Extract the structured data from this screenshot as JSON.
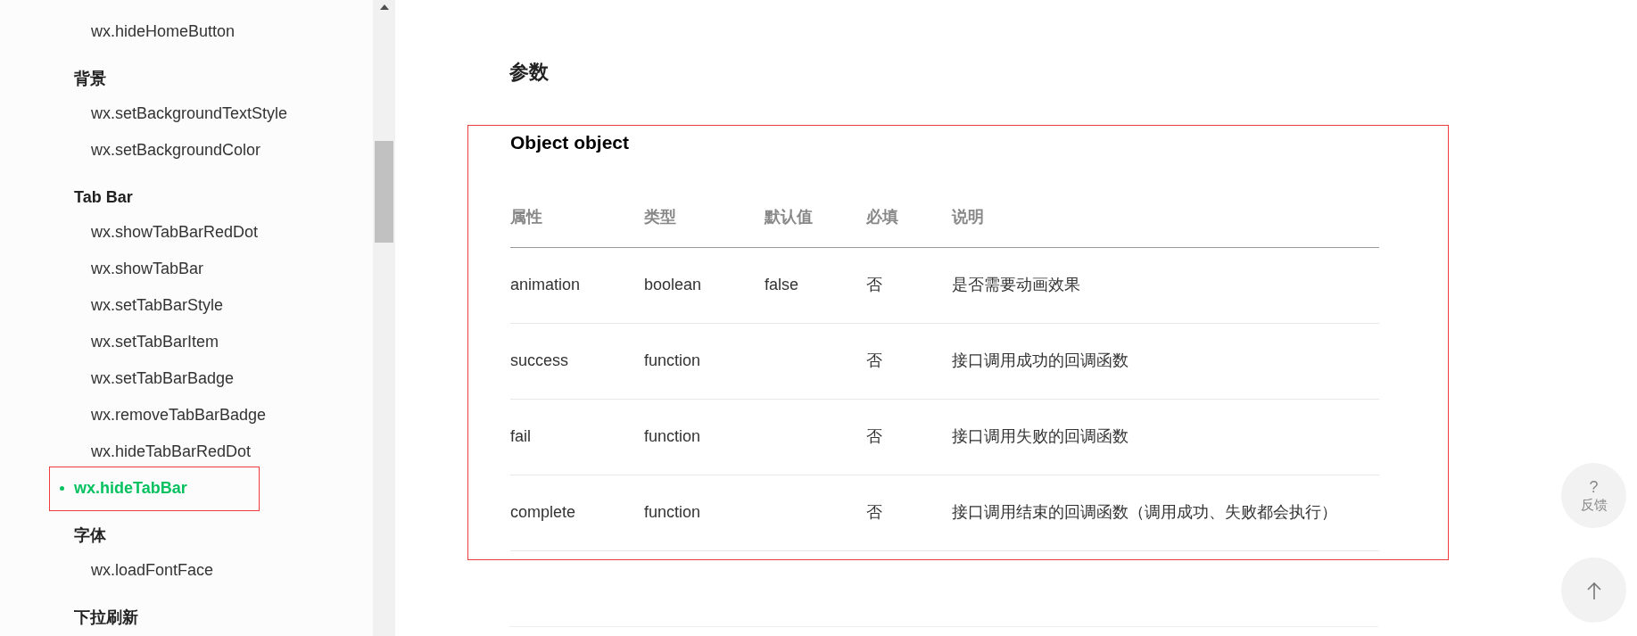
{
  "sidebar": {
    "groups": [
      {
        "items": [
          {
            "label": "wx.hideHomeButton",
            "selected": false
          }
        ]
      },
      {
        "title": "背景",
        "items": [
          {
            "label": "wx.setBackgroundTextStyle",
            "selected": false
          },
          {
            "label": "wx.setBackgroundColor",
            "selected": false
          }
        ]
      },
      {
        "title": "Tab Bar",
        "items": [
          {
            "label": "wx.showTabBarRedDot",
            "selected": false
          },
          {
            "label": "wx.showTabBar",
            "selected": false
          },
          {
            "label": "wx.setTabBarStyle",
            "selected": false
          },
          {
            "label": "wx.setTabBarItem",
            "selected": false
          },
          {
            "label": "wx.setTabBarBadge",
            "selected": false
          },
          {
            "label": "wx.removeTabBarBadge",
            "selected": false
          },
          {
            "label": "wx.hideTabBarRedDot",
            "selected": false
          },
          {
            "label": "wx.hideTabBar",
            "selected": true
          }
        ]
      },
      {
        "title": "字体",
        "items": [
          {
            "label": "wx.loadFontFace",
            "selected": false
          }
        ]
      },
      {
        "title": "下拉刷新"
      }
    ]
  },
  "content": {
    "heading": "参数",
    "table_title": "Object object",
    "table": {
      "columns": [
        "属性",
        "类型",
        "默认值",
        "必填",
        "说明"
      ],
      "rows": [
        [
          "animation",
          "boolean",
          "false",
          "否",
          "是否需要动画效果"
        ],
        [
          "success",
          "function",
          "",
          "否",
          "接口调用成功的回调函数"
        ],
        [
          "fail",
          "function",
          "",
          "否",
          "接口调用失败的回调函数"
        ],
        [
          "complete",
          "function",
          "",
          "否",
          "接口调用结束的回调函数（调用成功、失败都会执行）"
        ]
      ]
    }
  },
  "floating": {
    "feedback_symbol": "?",
    "feedback_label": "反馈"
  }
}
